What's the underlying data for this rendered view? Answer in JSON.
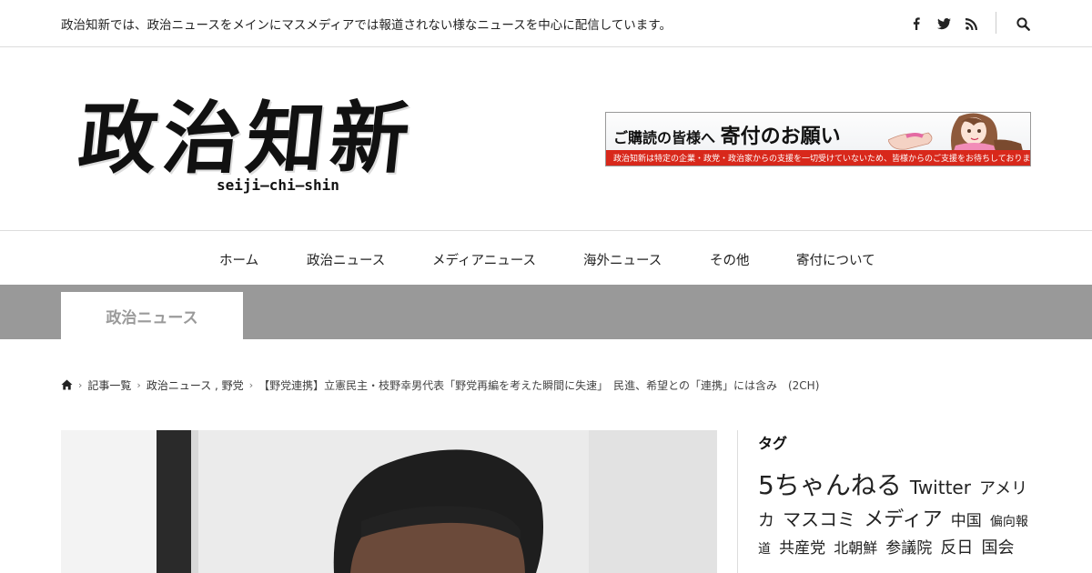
{
  "site": {
    "description": "政治知新では、政治ニュースをメインにマスメディアでは報道されない様なニュースを中心に配信しています。",
    "logo_kanji": "政治知新",
    "logo_romaji": "seiji–chi–shin"
  },
  "social": [
    "facebook-icon",
    "twitter-icon",
    "rss-icon",
    "search-icon"
  ],
  "banner": {
    "headline_small": "ご購読の皆様へ",
    "headline_large": "寄付のお願い",
    "subtext": "政治知新は特定の企業・政党・政治家からの支援を一切受けていないため、皆様からのご支援をお待ちしております。"
  },
  "nav": [
    "ホーム",
    "政治ニュース",
    "メディアニュース",
    "海外ニュース",
    "その他",
    "寄付について"
  ],
  "category": {
    "label": "政治ニュース"
  },
  "breadcrumb": {
    "home_icon": "home-icon",
    "items": [
      "記事一覧",
      "政治ニュース , 野党"
    ],
    "current": "【野党連携】立憲民主・枝野幸男代表「野党再編を考えた瞬間に失速」　民進、希望との「連携」には含み　(2CH)"
  },
  "sidebar": {
    "widget_title": "タグ",
    "tags": [
      {
        "label": "5ちゃんねる",
        "size": 28
      },
      {
        "label": "Twitter",
        "size": 20
      },
      {
        "label": "アメリカ",
        "size": 18
      },
      {
        "label": "マスコミ",
        "size": 20
      },
      {
        "label": "メディア",
        "size": 22
      },
      {
        "label": "中国",
        "size": 17
      },
      {
        "label": "偏向報道",
        "size": 14
      },
      {
        "label": "共産党",
        "size": 17
      },
      {
        "label": "北朝鮮",
        "size": 16
      },
      {
        "label": "参議院",
        "size": 17
      },
      {
        "label": "反日",
        "size": 18
      },
      {
        "label": "国会",
        "size": 18
      }
    ]
  },
  "colors": {
    "category_band": "#999999",
    "banner_strip": "#d8281b",
    "text": "#222222"
  }
}
